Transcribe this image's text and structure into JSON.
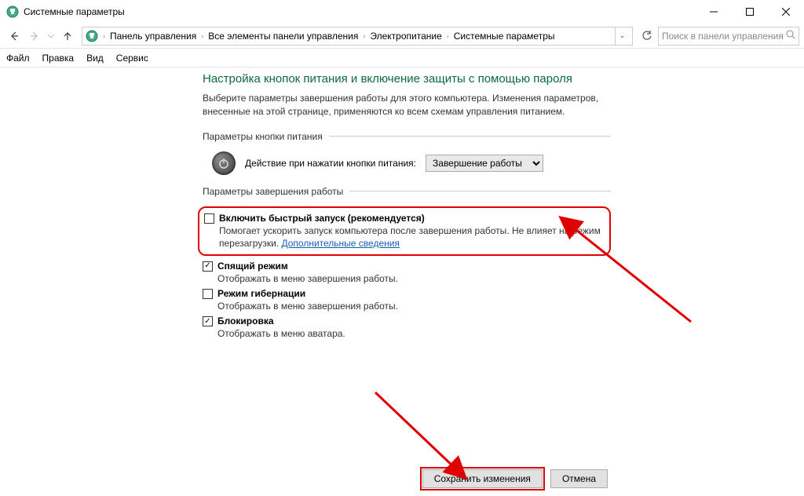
{
  "window": {
    "title": "Системные параметры"
  },
  "breadcrumb": {
    "items": [
      "Панель управления",
      "Все элементы панели управления",
      "Электропитание",
      "Системные параметры"
    ]
  },
  "search": {
    "placeholder": "Поиск в панели управления"
  },
  "menu": {
    "file": "Файл",
    "edit": "Правка",
    "view": "Вид",
    "tools": "Сервис"
  },
  "page": {
    "title": "Настройка кнопок питания и включение защиты с помощью пароля",
    "description": "Выберите параметры завершения работы для этого компьютера. Изменения параметров, внесенные на этой странице, применяются ко всем схемам управления питанием."
  },
  "group_power_button": {
    "header": "Параметры кнопки питания",
    "action_label": "Действие при нажатии кнопки питания:",
    "action_value": "Завершение работы"
  },
  "group_shutdown": {
    "header": "Параметры завершения работы",
    "fast_startup": {
      "label": "Включить быстрый запуск (рекомендуется)",
      "desc_prefix": "Помогает ускорить запуск компьютера после завершения работы. Не влияет на режим перезагрузки. ",
      "link": "Дополнительные сведения",
      "checked": false
    },
    "sleep": {
      "label": "Спящий режим",
      "desc": "Отображать в меню завершения работы.",
      "checked": true
    },
    "hibernate": {
      "label": "Режим гибернации",
      "desc": "Отображать в меню завершения работы.",
      "checked": false
    },
    "lock": {
      "label": "Блокировка",
      "desc": "Отображать в меню аватара.",
      "checked": true
    }
  },
  "buttons": {
    "save": "Сохранить изменения",
    "cancel": "Отмена"
  }
}
